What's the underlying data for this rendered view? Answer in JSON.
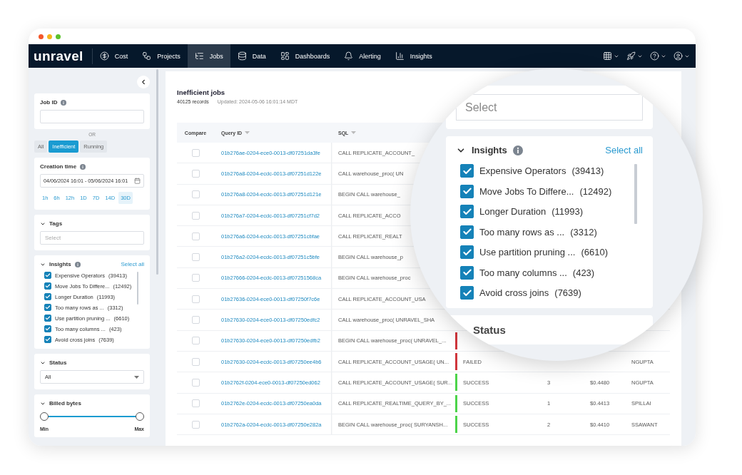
{
  "nav": {
    "logo": "unravel",
    "items": [
      {
        "label": "Cost",
        "kind": "cost",
        "selected": false
      },
      {
        "label": "Projects",
        "kind": "projects",
        "selected": false
      },
      {
        "label": "Jobs",
        "kind": "jobs",
        "selected": true
      },
      {
        "label": "Data",
        "kind": "data",
        "selected": false
      },
      {
        "label": "Dashboards",
        "kind": "dashboards",
        "selected": false
      },
      {
        "label": "Alerting",
        "kind": "alerting",
        "selected": false
      },
      {
        "label": "Insights",
        "kind": "insights",
        "selected": false
      }
    ]
  },
  "sidebar": {
    "job_id": {
      "label": "Job ID"
    },
    "or_label": "OR",
    "job_filters": [
      {
        "label": "All",
        "selected": false
      },
      {
        "label": "Inefficient",
        "selected": true
      },
      {
        "label": "Running",
        "selected": false
      }
    ],
    "creation_time": {
      "label": "Creation time",
      "value": "04/06/2024 16:01 - 05/06/2024 16:01",
      "presets": [
        {
          "label": "1h",
          "selected": false
        },
        {
          "label": "6h",
          "selected": false
        },
        {
          "label": "12h",
          "selected": false
        },
        {
          "label": "1D",
          "selected": false
        },
        {
          "label": "7D",
          "selected": false
        },
        {
          "label": "14D",
          "selected": false
        },
        {
          "label": "30D",
          "selected": true
        }
      ]
    },
    "tags": {
      "label": "Tags",
      "placeholder": "Select"
    },
    "insights": {
      "label": "Insights",
      "select_all": "Select all",
      "items": [
        {
          "label": "Expensive Operators",
          "count": "(39413)",
          "checked": true
        },
        {
          "label": "Move Jobs To Differe...",
          "count": "(12492)",
          "checked": true
        },
        {
          "label": "Longer Duration",
          "count": "(11993)",
          "checked": true
        },
        {
          "label": "Too many rows as ...",
          "count": "(3312)",
          "checked": true
        },
        {
          "label": "Use partition pruning ...",
          "count": "(6610)",
          "checked": true
        },
        {
          "label": "Too many columns ...",
          "count": "(423)",
          "checked": true
        },
        {
          "label": "Avoid cross joins",
          "count": "(7639)",
          "checked": true
        }
      ]
    },
    "status": {
      "label": "Status",
      "value": "All"
    },
    "billed_bytes": {
      "label": "Billed bytes",
      "level": 1,
      "min_label": "Min",
      "max_label": "Max"
    }
  },
  "main": {
    "title": "Inefficient jobs",
    "records": "40125 records",
    "updated": "Updated: 2024-05-06 16:01:14 MDT",
    "columns": [
      "Compare",
      "Query ID",
      "SQL"
    ],
    "rows": [
      {
        "checked": false,
        "query_id": "01b276ae-0204-ece0-0013-df07251da3fe",
        "sql": "CALL REPLICATE_ACCOUNT_"
      },
      {
        "checked": false,
        "query_id": "01b276a8-0204-ecdc-0013-df07251d122e",
        "sql": "CALL warehouse_proc( UN"
      },
      {
        "checked": false,
        "query_id": "01b276a8-0204-ecdc-0013-df07251d121e",
        "sql": "BEGIN CALL warehouse_"
      },
      {
        "checked": false,
        "query_id": "01b276a7-0204-ecdc-0013-df07251cf7d2",
        "sql": "CALL REPLICATE_ACCO"
      },
      {
        "checked": false,
        "query_id": "01b276a6-0204-ecdc-0013-df07251cbfae",
        "sql": "CALL REPLICATE_REALT"
      },
      {
        "checked": false,
        "query_id": "01b276a2-0204-ecdc-0013-df07251c5bfe",
        "sql": "BEGIN CALL warehouse_p"
      },
      {
        "checked": false,
        "query_id": "01b27666-0204-ecdc-0013-df07251568ca",
        "sql": "BEGIN CALL warehouse_proc"
      },
      {
        "checked": false,
        "query_id": "01b27636-0204-ece0-0013-df07250f7c6e",
        "sql": "CALL REPLICATE_ACCOUNT_USA"
      },
      {
        "checked": false,
        "query_id": "01b27630-0204-ece0-0013-df07250edfc2",
        "sql": "CALL warehouse_proc( UNRAVEL_SHA"
      },
      {
        "checked": false,
        "query_id": "01b27630-0204-ece0-0013-df07250edfb2",
        "sql": "BEGIN CALL warehouse_proc( UNRAVEL_...",
        "color": "#d0363c"
      },
      {
        "checked": false,
        "query_id": "01b27630-0204-ecdc-0013-df07250ee4b6",
        "sql": "CALL REPLICATE_ACCOUNT_USAGE( UN...",
        "color": "#d0363c",
        "status": "FAILED",
        "user": "NGUPTA"
      },
      {
        "checked": false,
        "query_id": "01b2762f-0204-ece0-0013-df07250ed062",
        "sql": "CALL REPLICATE_ACCOUNT_USAGE( SUR...",
        "color": "#4cd44a",
        "status": "SUCCESS",
        "runs": "3",
        "cost": "$0.4480",
        "user": "NGUPTA"
      },
      {
        "checked": false,
        "query_id": "01b2762e-0204-ecdc-0013-df07250ea0da",
        "sql": "CALL REPLICATE_REALTIME_QUERY_BY_...",
        "color": "#4cd44a",
        "status": "SUCCESS",
        "runs": "1",
        "cost": "$0.4413",
        "user": "SPILLAI"
      },
      {
        "checked": false,
        "query_id": "01b2762a-0204-ecdc-0013-df07250e282a",
        "sql": "BEGIN CALL warehouse_proc( SURYANSH...",
        "color": "#4cd44a",
        "status": "SUCCESS",
        "runs": "2",
        "cost": "$0.4410",
        "user": "SSAWANT"
      }
    ]
  },
  "magnifier": {
    "tags_placeholder": "Select",
    "insights": {
      "label": "Insights",
      "select_all": "Select all",
      "items": [
        {
          "label": "Expensive Operators",
          "count": "(39413)",
          "checked": true
        },
        {
          "label": "Move Jobs To Differe...",
          "count": "(12492)",
          "checked": true
        },
        {
          "label": "Longer Duration",
          "count": "(11993)",
          "checked": true
        },
        {
          "label": "Too many rows as ...",
          "count": "(3312)",
          "checked": true
        },
        {
          "label": "Use partition pruning ...",
          "count": "(6610)",
          "checked": true
        },
        {
          "label": "Too many columns ...",
          "count": "(423)",
          "checked": true
        },
        {
          "label": "Avoid cross joins",
          "count": "(7639)",
          "checked": true
        }
      ]
    },
    "status_label": "Status"
  }
}
